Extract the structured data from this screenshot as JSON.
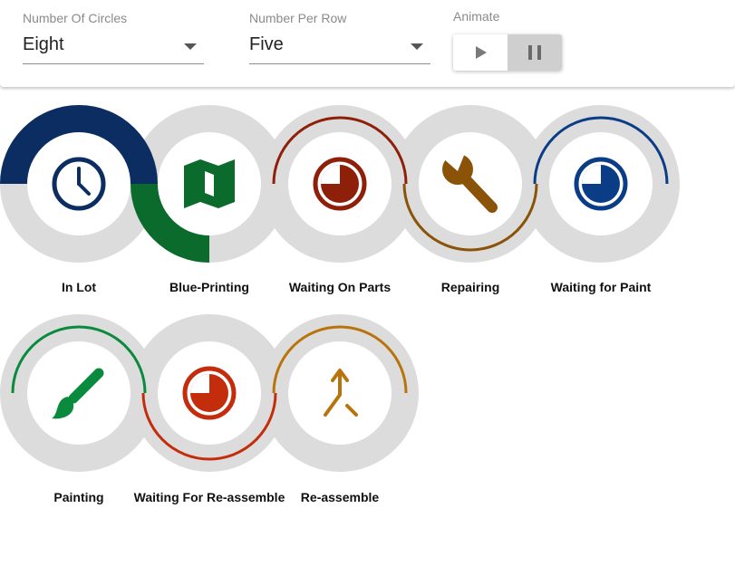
{
  "controls": {
    "number_of_circles": {
      "label": "Number Of Circles",
      "value": "Eight"
    },
    "number_per_row": {
      "label": "Number Per Row",
      "value": "Five"
    },
    "animate": {
      "label": "Animate",
      "selected": "pause"
    }
  },
  "circles": [
    {
      "label": "In Lot",
      "icon": "clock-icon",
      "color": "#0b2d62"
    },
    {
      "label": "Blue-Printing",
      "icon": "map-icon",
      "color": "#0a6b2c"
    },
    {
      "label": "Waiting On Parts",
      "icon": "pie-chart-icon",
      "color": "#8e1f08"
    },
    {
      "label": "Repairing",
      "icon": "wrench-icon",
      "color": "#8a5307"
    },
    {
      "label": "Waiting for Paint",
      "icon": "pie-chart-icon",
      "color": "#0b3d86"
    },
    {
      "label": "Painting",
      "icon": "paintbrush-icon",
      "color": "#0a8a3c"
    },
    {
      "label": "Waiting For Re-assemble",
      "icon": "pie-chart-icon",
      "color": "#c42d0c"
    },
    {
      "label": "Re-assemble",
      "icon": "merge-icon",
      "color": "#b8740a"
    }
  ],
  "colors": {
    "ring_track": "#dcdcdc",
    "inner_fill": "#ffffff"
  }
}
